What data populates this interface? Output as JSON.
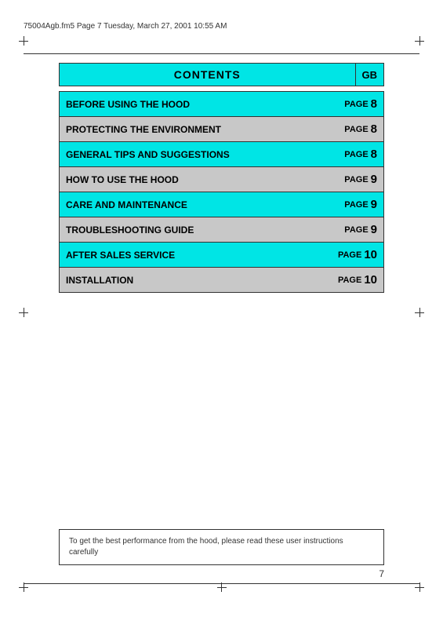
{
  "header": {
    "text": "75004Agb.fm5  Page 7  Tuesday, March 27, 2001  10:55 AM"
  },
  "contents": {
    "title": "CONTENTS",
    "gb_label": "GB",
    "rows": [
      {
        "label": "BEFORE USING THE HOOD",
        "page_text": "PAGE",
        "page_num": "8",
        "style": "cyan"
      },
      {
        "label": "PROTECTING THE ENVIRONMENT",
        "page_text": "PAGE",
        "page_num": "8",
        "style": "gray"
      },
      {
        "label": "GENERAL TIPS AND SUGGESTIONS",
        "page_text": "PAGE",
        "page_num": "8",
        "style": "cyan"
      },
      {
        "label": "HOW TO USE THE HOOD",
        "page_text": "PAGE",
        "page_num": "9",
        "style": "gray"
      },
      {
        "label": "CARE AND MAINTENANCE",
        "page_text": "PAGE",
        "page_num": "9",
        "style": "cyan"
      },
      {
        "label": "TROUBLESHOOTING GUIDE",
        "page_text": "PAGE",
        "page_num": "9",
        "style": "gray"
      },
      {
        "label": "AFTER SALES SERVICE",
        "page_text": "PAGE",
        "page_num": "10",
        "style": "cyan"
      },
      {
        "label": "INSTALLATION",
        "page_text": "PAGE",
        "page_num": "10",
        "style": "gray"
      }
    ]
  },
  "bottom_note": "To get the best performance from the hood, please read these user instructions carefully",
  "page_number": "7"
}
